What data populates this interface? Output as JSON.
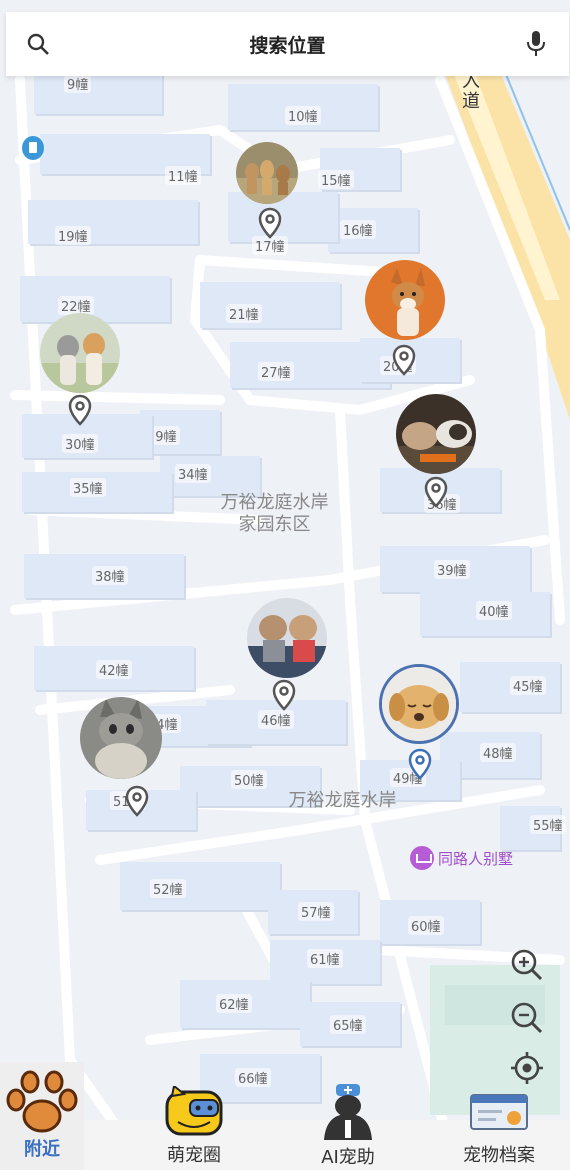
{
  "search": {
    "title": "搜索位置"
  },
  "map": {
    "road_label": "入\n道",
    "area_labels": [
      "万裕龙庭水岸\n家园东区",
      "万裕龙庭水岸"
    ],
    "poi": "同路人别墅",
    "buildings": [
      "9幢",
      "10幢",
      "11幢",
      "15幢",
      "16幢",
      "17幢",
      "19幢",
      "21幢",
      "22幢",
      "27幢",
      "20幢",
      "29幢",
      "30幢",
      "34幢",
      "35幢",
      "36幢",
      "38幢",
      "39幢",
      "40幢",
      "42幢",
      "44幢",
      "45幢",
      "46幢",
      "48幢",
      "49幢",
      "50幢",
      "51幢",
      "52幢",
      "55幢",
      "57幢",
      "60幢",
      "61幢",
      "62幢",
      "65幢",
      "66幢"
    ]
  },
  "pets": [
    {
      "name": "three-dogs"
    },
    {
      "name": "corgi"
    },
    {
      "name": "two-dogs"
    },
    {
      "name": "guinea-pigs"
    },
    {
      "name": "yorkies"
    },
    {
      "name": "golden-retriever"
    },
    {
      "name": "cat"
    }
  ],
  "tabs": [
    {
      "label": "附近",
      "icon": "paw-icon",
      "active": true
    },
    {
      "label": "萌宠圈",
      "icon": "pet-circle-icon",
      "active": false
    },
    {
      "label": "AI宠助",
      "icon": "ai-assistant-icon",
      "active": false
    },
    {
      "label": "宠物档案",
      "icon": "pet-file-icon",
      "active": false
    }
  ],
  "colors": {
    "accent": "#3b70c2",
    "paw": "#e08a3c",
    "pin": "#555555",
    "road_main": "#fbe3a8"
  }
}
